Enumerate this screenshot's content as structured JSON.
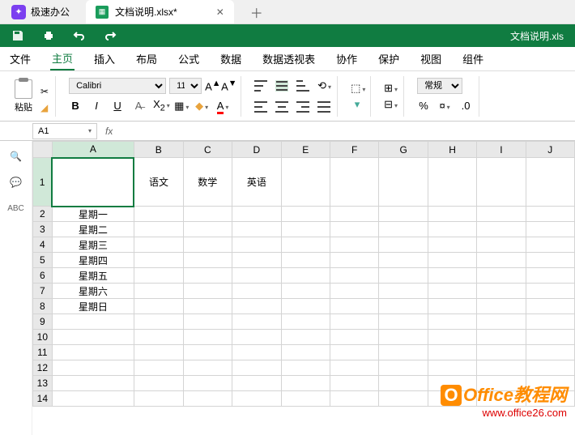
{
  "app": {
    "name": "极速办公"
  },
  "tab": {
    "filename": "文档说明.xlsx*"
  },
  "qat": {
    "filename_display": "文档说明.xls"
  },
  "menu": {
    "file": "文件",
    "home": "主页",
    "insert": "插入",
    "layout": "布局",
    "formula": "公式",
    "data": "数据",
    "pivot": "数据透视表",
    "collab": "协作",
    "protect": "保护",
    "view": "视图",
    "component": "组件"
  },
  "ribbon": {
    "paste": "粘贴",
    "font_name": "Calibri",
    "font_size": "11",
    "number_format": "常规"
  },
  "namebox": {
    "ref": "A1"
  },
  "columns": [
    "A",
    "B",
    "C",
    "D",
    "E",
    "F",
    "G",
    "H",
    "I",
    "J"
  ],
  "rows": [
    "1",
    "2",
    "3",
    "4",
    "5",
    "6",
    "7",
    "8",
    "9",
    "10",
    "11",
    "12",
    "13",
    "14"
  ],
  "cells": {
    "B1": "语文",
    "C1": "数学",
    "D1": "英语",
    "A2": "星期一",
    "A3": "星期二",
    "A4": "星期三",
    "A5": "星期四",
    "A6": "星期五",
    "A7": "星期六",
    "A8": "星期日"
  },
  "watermark": {
    "brand": "Office教程网",
    "url": "www.office26.com"
  }
}
